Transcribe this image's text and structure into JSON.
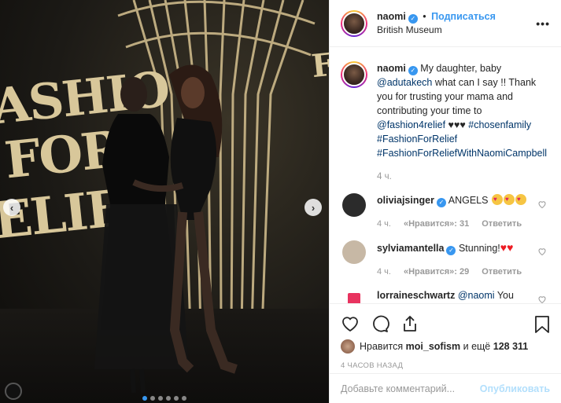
{
  "photo": {
    "backdrop_words": [
      "ASHIO",
      "FOR",
      "ELIE"
    ],
    "dots": 6,
    "active_dot": 0
  },
  "header": {
    "username": "naomi",
    "separator": "•",
    "follow_label": "Подписаться",
    "location": "British Museum"
  },
  "caption": {
    "username": "naomi",
    "text_1": "My daughter, baby",
    "mention": "@adutakech",
    "text_2": "what can I say !! Thank you for trusting your mama and contributing your time to",
    "mention_2": "@fashion4relief",
    "hearts": "♥♥♥",
    "tags": [
      "#chosenfamily",
      "#FashionForRelief",
      "#FashionForReliefWithNaomiCampbell"
    ],
    "time": "4 ч."
  },
  "comments": [
    {
      "username": "oliviajsinger",
      "text": "ANGELS",
      "time": "4 ч.",
      "likes": "«Нравится»: 31",
      "reply": "Ответить",
      "avatar_color": "#2b2b2b"
    },
    {
      "username": "sylviamantella",
      "text": "Stunning!",
      "time": "4 ч.",
      "likes": "«Нравится»: 29",
      "reply": "Ответить",
      "avatar_color": "#c7b8a5"
    },
    {
      "username": "lorraineschwartz",
      "mention": "@naomi",
      "text": "You never stop and always push",
      "avatar_color": "#e8335f"
    }
  ],
  "likes": {
    "prefix": "Нравится",
    "user": "moi_sofism",
    "suffix": "и ещё",
    "count": "128 311"
  },
  "posted_ago": "4 ЧАСОВ НАЗАД",
  "add_comment": {
    "placeholder": "Добавьте комментарий...",
    "post_label": "Опубликовать"
  },
  "colors": {
    "link": "#003569",
    "accent": "#3897f0",
    "muted": "#999999"
  }
}
